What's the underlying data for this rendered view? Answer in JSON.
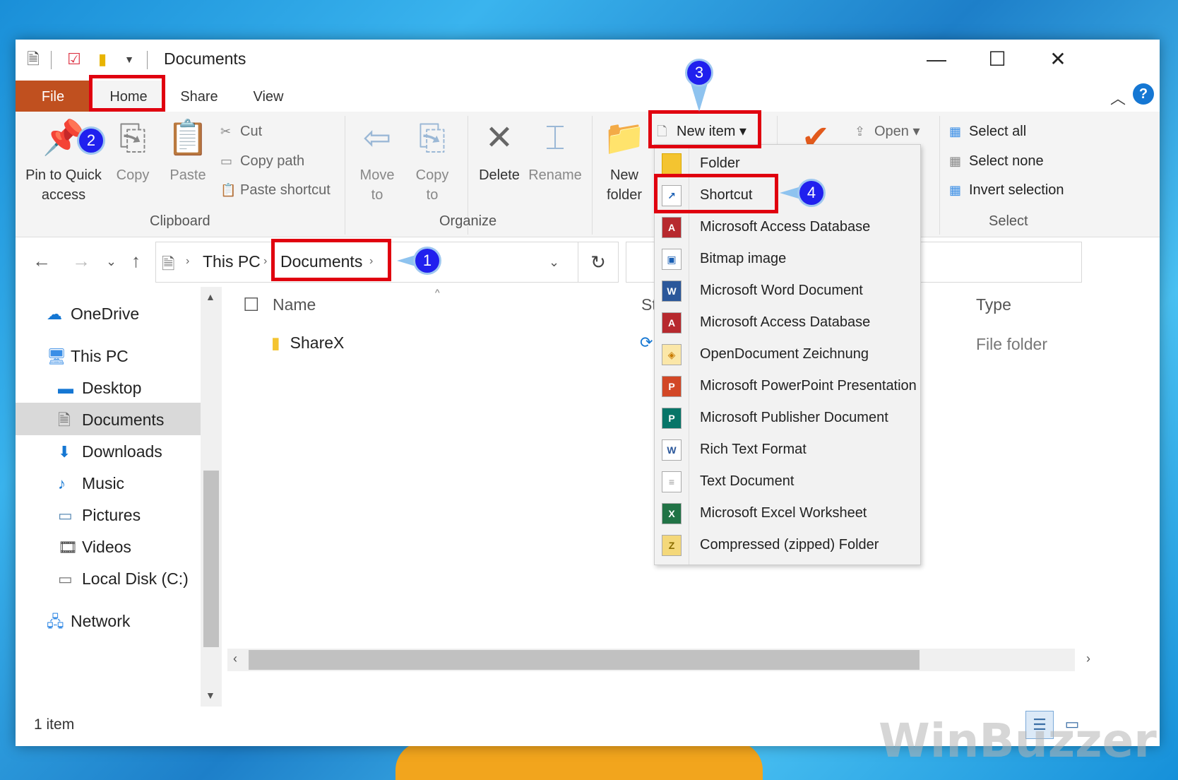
{
  "window": {
    "title": "Documents",
    "minimize": "—",
    "maximize": "☐",
    "close": "✕"
  },
  "tabs": {
    "file": "File",
    "home": "Home",
    "share": "Share",
    "view": "View"
  },
  "ribbon": {
    "clipboard": {
      "label": "Clipboard",
      "pin": "Pin to Quick access",
      "copy": "Copy",
      "paste": "Paste",
      "cut": "Cut",
      "copy_path": "Copy path",
      "paste_shortcut": "Paste shortcut"
    },
    "organize": {
      "label": "Organize",
      "move_to": "Move to",
      "copy_to": "Copy to",
      "delete": "Delete",
      "rename": "Rename"
    },
    "new": {
      "new_folder": "New folder",
      "new_item": "New item"
    },
    "open": {
      "open": "Open"
    },
    "select": {
      "label": "Select",
      "select_all": "Select all",
      "select_none": "Select none",
      "invert": "Invert selection"
    }
  },
  "address": {
    "this_pc": "This PC",
    "documents": "Documents"
  },
  "nav_pane": [
    {
      "label": "OneDrive",
      "icon": "cloud-icon"
    },
    {
      "label": "This PC",
      "icon": "computer-icon"
    },
    {
      "label": "Desktop",
      "icon": "desktop-icon"
    },
    {
      "label": "Documents",
      "icon": "documents-icon"
    },
    {
      "label": "Downloads",
      "icon": "downloads-icon"
    },
    {
      "label": "Music",
      "icon": "music-icon"
    },
    {
      "label": "Pictures",
      "icon": "pictures-icon"
    },
    {
      "label": "Videos",
      "icon": "videos-icon"
    },
    {
      "label": "Local Disk (C:)",
      "icon": "disk-icon"
    },
    {
      "label": "Network",
      "icon": "network-icon"
    }
  ],
  "columns": {
    "name": "Name",
    "status": "St",
    "type": "Type"
  },
  "files": [
    {
      "name": "ShareX",
      "type": "File folder"
    }
  ],
  "status": "1 item",
  "new_item_menu": [
    {
      "label": "Folder",
      "badge": ""
    },
    {
      "label": "Shortcut",
      "badge": "↗"
    },
    {
      "label": "Microsoft Access Database",
      "badge": "A"
    },
    {
      "label": "Bitmap image",
      "badge": "▣"
    },
    {
      "label": "Microsoft Word Document",
      "badge": "W"
    },
    {
      "label": "Microsoft Access Database",
      "badge": "A"
    },
    {
      "label": "OpenDocument Zeichnung",
      "badge": "◈"
    },
    {
      "label": "Microsoft PowerPoint Presentation",
      "badge": "P"
    },
    {
      "label": "Microsoft Publisher Document",
      "badge": "P"
    },
    {
      "label": "Rich Text Format",
      "badge": "W"
    },
    {
      "label": "Text Document",
      "badge": "≡"
    },
    {
      "label": "Microsoft Excel Worksheet",
      "badge": "X"
    },
    {
      "label": "Compressed (zipped) Folder",
      "badge": "Z"
    }
  ],
  "markers": {
    "m1": "1",
    "m2": "2",
    "m3": "3",
    "m4": "4"
  },
  "watermark": "WinBuzzer",
  "colors": {
    "file_tab": "#c0501f",
    "highlight": "#e0000f",
    "marker": "#2020ee"
  }
}
